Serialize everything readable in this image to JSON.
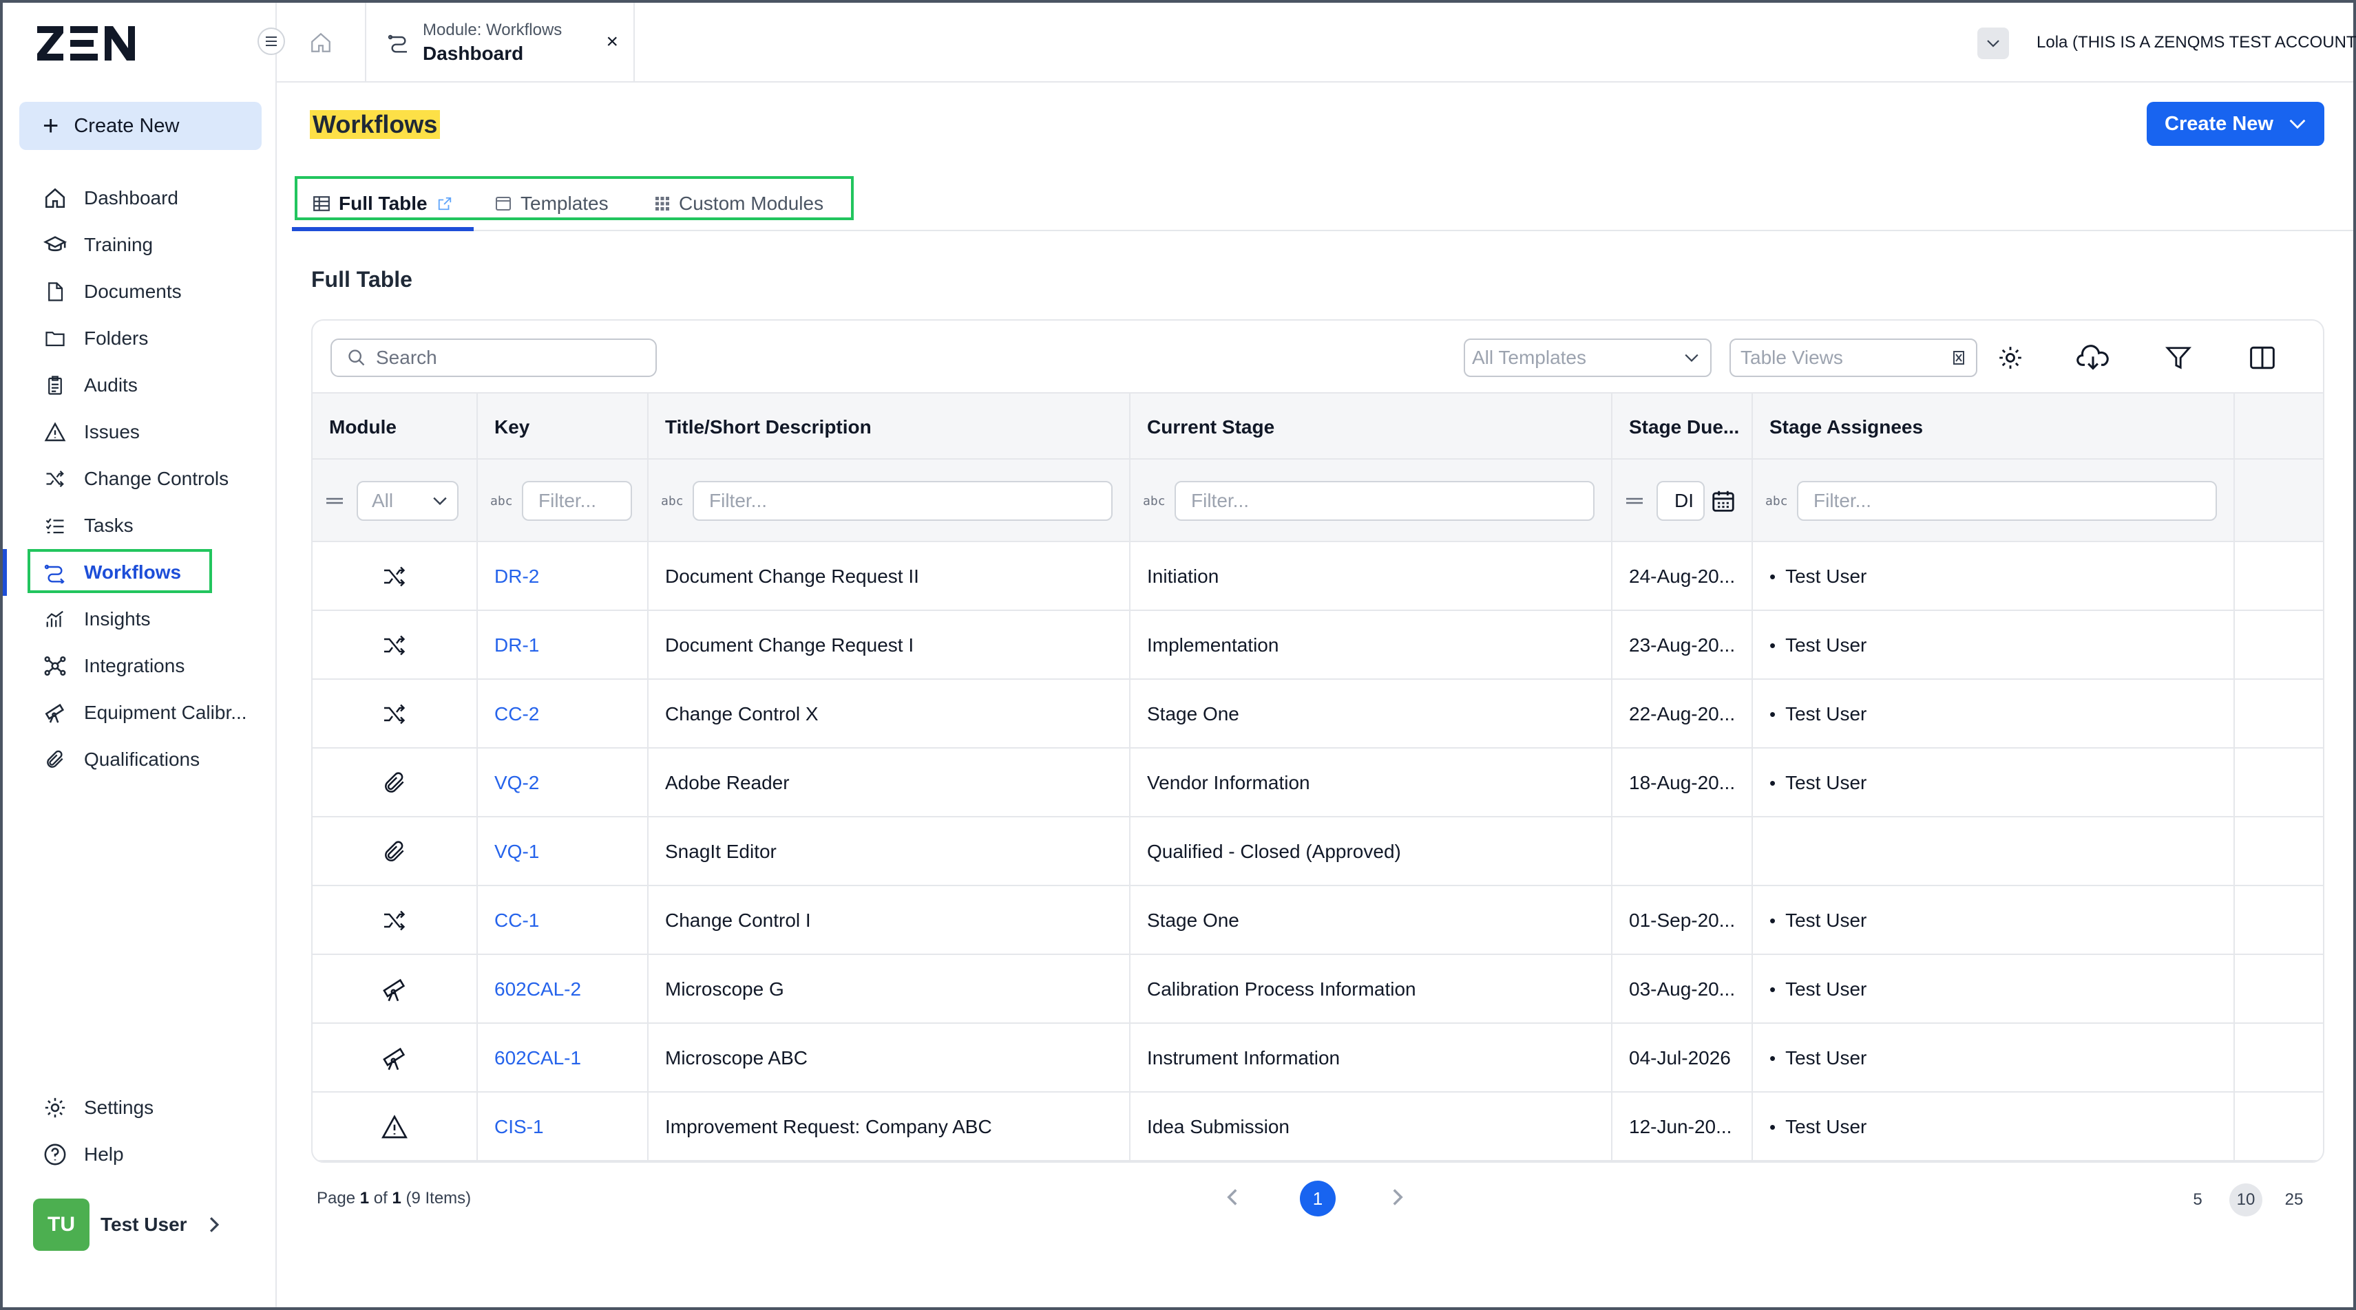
{
  "app": {
    "logo_text": "ZEN",
    "account": "Lola (THIS IS A ZENQMS TEST ACCOUNT)"
  },
  "sidebar": {
    "create_new": "Create New",
    "items": [
      {
        "label": "Dashboard",
        "icon": "home-icon"
      },
      {
        "label": "Training",
        "icon": "graduation-cap-icon"
      },
      {
        "label": "Documents",
        "icon": "document-icon"
      },
      {
        "label": "Folders",
        "icon": "folder-icon"
      },
      {
        "label": "Audits",
        "icon": "clipboard-icon"
      },
      {
        "label": "Issues",
        "icon": "warning-icon"
      },
      {
        "label": "Change Controls",
        "icon": "shuffle-icon"
      },
      {
        "label": "Tasks",
        "icon": "checklist-icon"
      },
      {
        "label": "Workflows",
        "icon": "workflow-icon",
        "active": true
      },
      {
        "label": "Insights",
        "icon": "chart-icon"
      },
      {
        "label": "Integrations",
        "icon": "network-icon"
      },
      {
        "label": "Equipment Calibr...",
        "icon": "telescope-icon"
      },
      {
        "label": "Qualifications",
        "icon": "paperclip-icon"
      }
    ],
    "bottom": [
      {
        "label": "Settings",
        "icon": "gear-icon"
      },
      {
        "label": "Help",
        "icon": "help-icon"
      }
    ],
    "user": {
      "initials": "TU",
      "name": "Test User"
    }
  },
  "topbar": {
    "tab_sub": "Module: Workflows",
    "tab_main": "Dashboard",
    "close": "×"
  },
  "page": {
    "title": "Workflows",
    "create_new": "Create New",
    "tabs": [
      {
        "label": "Full Table",
        "active": true
      },
      {
        "label": "Templates"
      },
      {
        "label": "Custom Modules"
      }
    ],
    "section_title": "Full Table"
  },
  "toolbar": {
    "search_placeholder": "Search",
    "templates_select": "All Templates",
    "views_placeholder": "Table Views"
  },
  "table": {
    "columns": [
      "Module",
      "Key",
      "Title/Short Description",
      "Current Stage",
      "Stage Due...",
      "Stage Assignees"
    ],
    "filters": {
      "module": "All",
      "key": "Filter...",
      "title": "Filter...",
      "stage": "Filter...",
      "due": "DI",
      "assignees": "Filter..."
    },
    "rows": [
      {
        "icon": "shuffle-icon",
        "key": "DR-2",
        "title": "Document Change Request II",
        "stage": "Initiation",
        "due": "24-Aug-20...",
        "assignee": "Test User"
      },
      {
        "icon": "shuffle-icon",
        "key": "DR-1",
        "title": "Document Change Request I",
        "stage": "Implementation",
        "due": "23-Aug-20...",
        "assignee": "Test User"
      },
      {
        "icon": "shuffle-icon",
        "key": "CC-2",
        "title": "Change Control X",
        "stage": "Stage One",
        "due": "22-Aug-20...",
        "assignee": "Test User"
      },
      {
        "icon": "paperclip-icon",
        "key": "VQ-2",
        "title": "Adobe Reader",
        "stage": "Vendor Information",
        "due": "18-Aug-20...",
        "assignee": "Test User"
      },
      {
        "icon": "paperclip-icon",
        "key": "VQ-1",
        "title": "SnagIt Editor",
        "stage": "Qualified - Closed (Approved)",
        "due": "",
        "assignee": ""
      },
      {
        "icon": "shuffle-icon",
        "key": "CC-1",
        "title": "Change Control I",
        "stage": "Stage One",
        "due": "01-Sep-20...",
        "assignee": "Test User"
      },
      {
        "icon": "telescope-icon",
        "key": "602CAL-2",
        "title": "Microscope G",
        "stage": "Calibration Process Information",
        "due": "03-Aug-20...",
        "assignee": "Test User"
      },
      {
        "icon": "telescope-icon",
        "key": "602CAL-1",
        "title": "Microscope ABC",
        "stage": "Instrument Information",
        "due": "04-Jul-2026",
        "assignee": "Test User"
      },
      {
        "icon": "warning-icon",
        "key": "CIS-1",
        "title": "Improvement Request: Company ABC",
        "stage": "Idea Submission",
        "due": "12-Jun-20...",
        "assignee": "Test User"
      }
    ]
  },
  "pagination": {
    "page_word": "Page",
    "current": "1",
    "of_word": "of",
    "total_pages": "1",
    "items": "(9 Items)",
    "page_sizes": [
      "5",
      "10",
      "25"
    ],
    "selected_size": "10"
  },
  "colors": {
    "accent": "#1864f0",
    "link": "#2563eb",
    "highlight": "#fde047",
    "annotation": "#22c55e",
    "avatar": "#4caf50"
  }
}
